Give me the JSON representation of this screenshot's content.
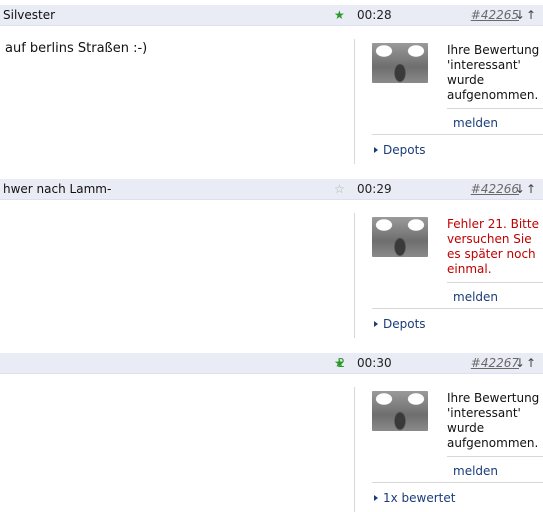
{
  "posts": [
    {
      "title": "Silvester",
      "score": "",
      "star": "filled",
      "time": "00:28",
      "post_id": "#42265",
      "arrows": "↓↑",
      "text": "auf berlins Straßen :-)",
      "message": "Ihre Bewertung 'interessant' wurde aufgenommen.",
      "message_type": "info",
      "report_label": "melden",
      "footer_label": "Depots"
    },
    {
      "title": "hwer nach Lamm-",
      "score": "",
      "star": "empty",
      "time": "00:29",
      "post_id": "#42266",
      "arrows": "↓↑",
      "text": "",
      "message": "Fehler 21. Bitte versuchen Sie es später noch einmal.",
      "message_type": "error",
      "report_label": "melden",
      "footer_label": "Depots"
    },
    {
      "title": "",
      "score": "2",
      "star": "filled",
      "time": "00:30",
      "post_id": "#42267",
      "arrows": "↓↑",
      "text": "",
      "message": "Ihre Bewertung 'interessant' wurde aufgenommen.",
      "message_type": "info",
      "report_label": "melden",
      "footer_label": "1x bewertet"
    }
  ],
  "colors": {
    "header_bg": "#e9ebf5",
    "star_active": "#2a9a2a",
    "link": "#1a3c7a",
    "error": "#c00000"
  }
}
